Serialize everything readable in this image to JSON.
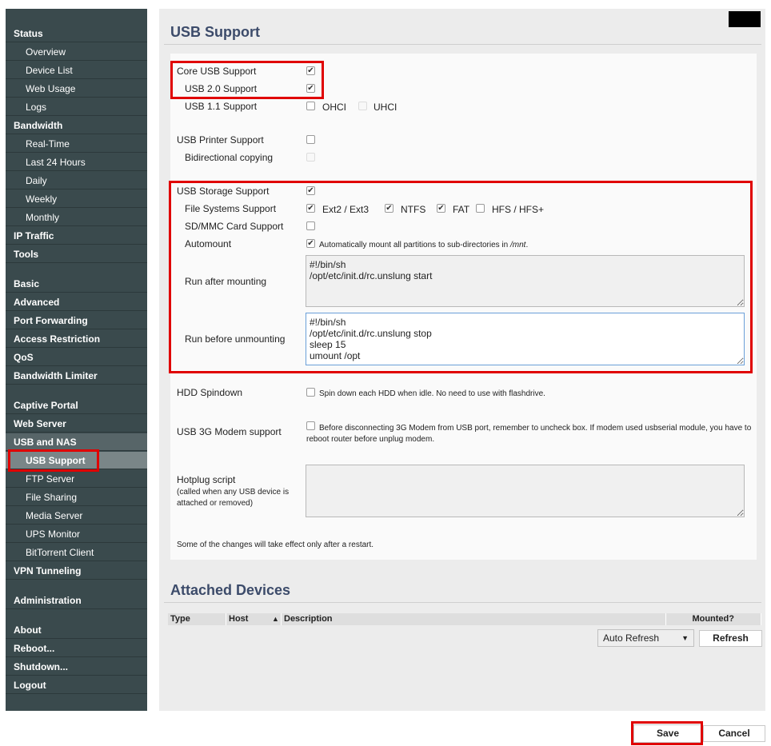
{
  "sidebar": {
    "status": "Status",
    "overview": "Overview",
    "device_list": "Device List",
    "web_usage": "Web Usage",
    "logs": "Logs",
    "bandwidth": "Bandwidth",
    "real_time": "Real-Time",
    "last24": "Last 24 Hours",
    "daily": "Daily",
    "weekly": "Weekly",
    "monthly": "Monthly",
    "ip_traffic": "IP Traffic",
    "tools": "Tools",
    "basic": "Basic",
    "advanced": "Advanced",
    "port_forwarding": "Port Forwarding",
    "access_restriction": "Access Restriction",
    "qos": "QoS",
    "bandwidth_limiter": "Bandwidth Limiter",
    "captive_portal": "Captive Portal",
    "web_server": "Web Server",
    "usb_nas": "USB and NAS",
    "usb_support": "USB Support",
    "ftp_server": "FTP Server",
    "file_sharing": "File Sharing",
    "media_server": "Media Server",
    "ups_monitor": "UPS Monitor",
    "bittorrent": "BitTorrent Client",
    "vpn": "VPN Tunneling",
    "administration": "Administration",
    "about": "About",
    "reboot": "Reboot...",
    "shutdown": "Shutdown...",
    "logout": "Logout"
  },
  "page_title": "USB Support",
  "form": {
    "core_usb": "Core USB Support",
    "usb2": "USB 2.0 Support",
    "usb11": "USB 1.1 Support",
    "ohci": "OHCI",
    "uhci": "UHCI",
    "printer": "USB Printer Support",
    "bidir": "Bidirectional copying",
    "storage": "USB Storage Support",
    "fs_support": "File Systems Support",
    "ext": "Ext2 / Ext3",
    "ntfs": "NTFS",
    "fat": "FAT",
    "hfs": "HFS / HFS+",
    "sdmmc": "SD/MMC Card Support",
    "automount": "Automount",
    "automount_desc_pre": "Automatically mount all partitions to sub-directories in ",
    "automount_desc_path": "/mnt",
    "automount_desc_post": ".",
    "run_after": "Run after mounting",
    "run_after_value": "#!/bin/sh\n/opt/etc/init.d/rc.unslung start",
    "run_before": "Run before unmounting",
    "run_before_value": "#!/bin/sh\n/opt/etc/init.d/rc.unslung stop\nsleep 15\numount /opt",
    "hdd_spindown": "HDD Spindown",
    "hdd_desc": "Spin down each HDD when idle. No need to use with flashdrive.",
    "modem": "USB 3G Modem support",
    "modem_desc_1": "Before disconnecting 3G Modem from USB port, remember to uncheck box. If modem used usbserial module, you have to",
    "modem_desc_2": "reboot router before unplug modem.",
    "hotplug": "Hotplug script",
    "hotplug_note_1": "(called when any USB device is",
    "hotplug_note_2": "attached or removed)",
    "hotplug_value": "",
    "restart_note": "Some of the changes will take effect only after a restart."
  },
  "checkbox_states": {
    "core_usb": true,
    "usb2": true,
    "ohci": false,
    "uhci": false,
    "printer": false,
    "bidir": false,
    "storage": true,
    "ext": true,
    "ntfs": true,
    "fat": true,
    "hfs": false,
    "sdmmc": false,
    "automount": true,
    "hdd": false,
    "modem": false
  },
  "attached": {
    "title": "Attached Devices",
    "col_type": "Type",
    "col_host": "Host",
    "sort_icon": "▲",
    "col_desc": "Description",
    "col_mounted": "Mounted?",
    "auto_refresh": "Auto Refresh",
    "refresh": "Refresh"
  },
  "buttons": {
    "save": "Save",
    "cancel": "Cancel"
  },
  "colors": {
    "sidebar": "#3a4a4d",
    "highlight": "#e00000",
    "title": "#3c4b6a"
  }
}
